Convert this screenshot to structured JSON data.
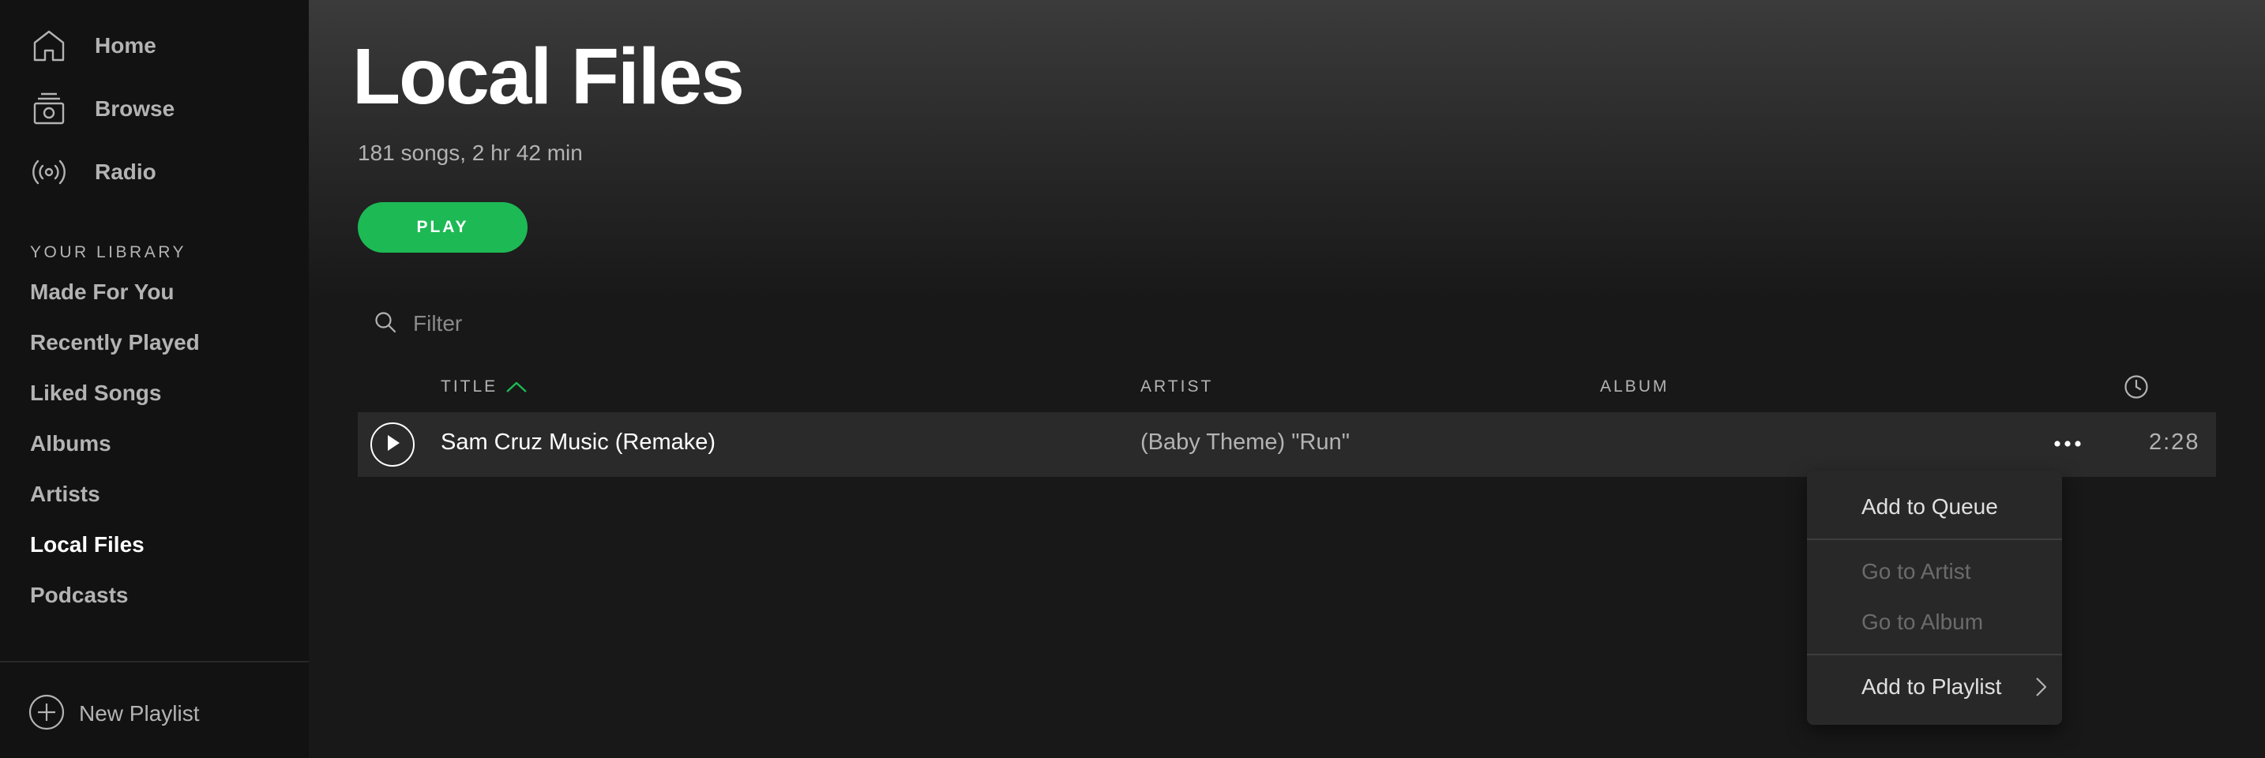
{
  "sidebar": {
    "nav": [
      {
        "label": "Home",
        "icon": "home-icon"
      },
      {
        "label": "Browse",
        "icon": "browse-icon"
      },
      {
        "label": "Radio",
        "icon": "radio-icon"
      }
    ],
    "library_heading": "YOUR LIBRARY",
    "library": [
      {
        "label": "Made For You"
      },
      {
        "label": "Recently Played"
      },
      {
        "label": "Liked Songs"
      },
      {
        "label": "Albums"
      },
      {
        "label": "Artists"
      },
      {
        "label": "Local Files",
        "active": true
      },
      {
        "label": "Podcasts"
      }
    ],
    "new_playlist_label": "New Playlist"
  },
  "main": {
    "title": "Local Files",
    "meta": "181 songs, 2 hr 42 min",
    "play_label": "PLAY",
    "filter_placeholder": "Filter",
    "columns": {
      "title": "TITLE",
      "artist": "ARTIST",
      "album": "ALBUM",
      "duration_icon": "clock-icon"
    },
    "sort": {
      "column": "title",
      "direction": "ascending"
    },
    "tracks": [
      {
        "title": "Sam Cruz Music (Remake)",
        "artist": "(Baby Theme) \"Run\"",
        "album": "",
        "duration": "2:28"
      }
    ]
  },
  "context_menu": {
    "items": [
      {
        "label": "Add to Queue",
        "enabled": true
      },
      {
        "label": "Go to Artist",
        "enabled": false
      },
      {
        "label": "Go to Album",
        "enabled": false
      },
      {
        "label": "Add to Playlist",
        "enabled": true,
        "submenu": true
      }
    ]
  },
  "colors": {
    "accent": "#1db954",
    "sidebar_bg": "#121212",
    "main_bg": "#181818",
    "row_hover": "#2a2a2a",
    "menu_bg": "#282828"
  }
}
